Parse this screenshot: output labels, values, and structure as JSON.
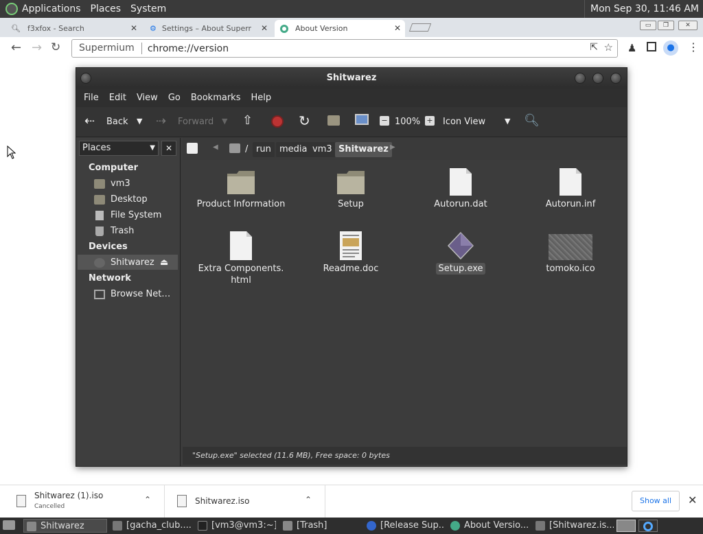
{
  "top_panel": {
    "menus": [
      "Applications",
      "Places",
      "System"
    ],
    "clock": "Mon Sep 30, 11:46 AM"
  },
  "browser": {
    "tabs": [
      {
        "label": "f3xfox - Search"
      },
      {
        "label": "Settings – About Superm"
      },
      {
        "label": "About Version"
      }
    ],
    "omnibox": {
      "chip": "Supermium",
      "url": "chrome://version"
    }
  },
  "file_manager": {
    "title": "Shitwarez",
    "menu": [
      "File",
      "Edit",
      "View",
      "Go",
      "Bookmarks",
      "Help"
    ],
    "toolbar": {
      "back": "Back",
      "forward": "Forward",
      "zoom": "100%",
      "view_mode": "Icon View"
    },
    "sidebar": {
      "selector": "Places",
      "sections": [
        {
          "header": "Computer",
          "items": [
            "vm3",
            "Desktop",
            "File System",
            "Trash"
          ]
        },
        {
          "header": "Devices",
          "items": [
            "Shitwarez"
          ]
        },
        {
          "header": "Network",
          "items": [
            "Browse Net…"
          ]
        }
      ]
    },
    "path": [
      "/",
      "run",
      "media",
      "vm3",
      "Shitwarez"
    ],
    "files": [
      {
        "name": "Product Information",
        "type": "folder"
      },
      {
        "name": "Setup",
        "type": "folder"
      },
      {
        "name": "Autorun.dat",
        "type": "file"
      },
      {
        "name": "Autorun.inf",
        "type": "file"
      },
      {
        "name": "Extra Components.\nhtml",
        "type": "file"
      },
      {
        "name": "Readme.doc",
        "type": "doc"
      },
      {
        "name": "Setup.exe",
        "type": "exe"
      },
      {
        "name": "tomoko.ico",
        "type": "image"
      }
    ],
    "status": "\"Setup.exe\" selected (11.6 MB), Free space: 0 bytes"
  },
  "downloads": {
    "items": [
      {
        "name": "Shitwarez (1).iso",
        "status": "Cancelled"
      },
      {
        "name": "Shitwarez.iso",
        "status": ""
      }
    ],
    "show_all": "Show all"
  },
  "taskbar": {
    "items": [
      "Shitwarez",
      "[gacha_club....",
      "[vm3@vm3:~]",
      "[Trash]",
      "[Release Sup...",
      "About Versio...",
      "[Shitwarez.is..."
    ]
  }
}
